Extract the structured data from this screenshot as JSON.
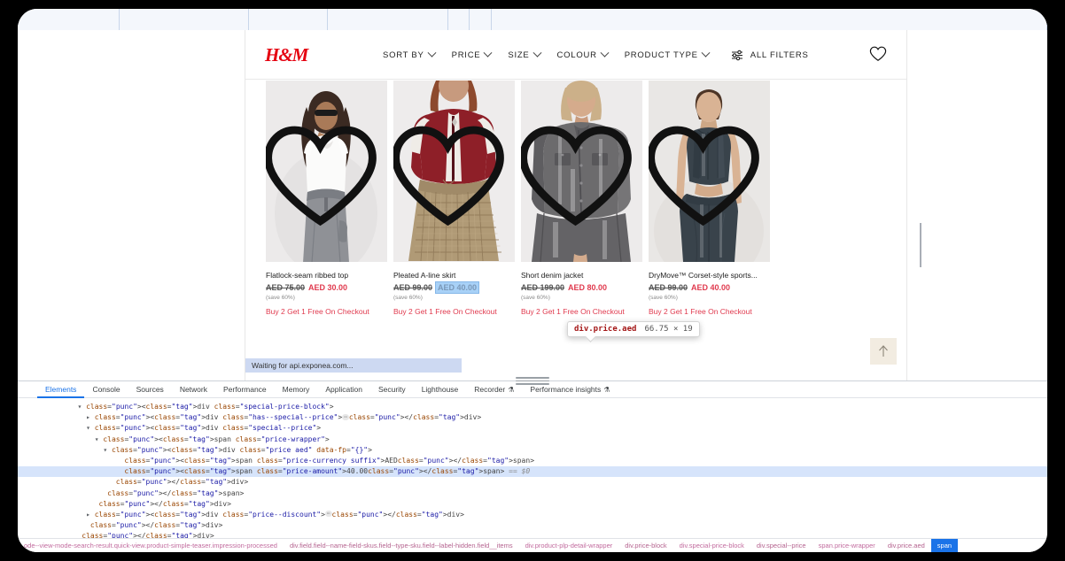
{
  "browser": {
    "tab_strip_segments": 7
  },
  "site": {
    "brand_logo": "H&M",
    "brand_color": "#e50010",
    "filters": [
      {
        "label": "SORT BY",
        "has_chevron": true,
        "icon": "chevron-down-icon"
      },
      {
        "label": "PRICE",
        "has_chevron": true,
        "icon": "chevron-down-icon"
      },
      {
        "label": "SIZE",
        "has_chevron": true,
        "icon": "chevron-down-icon"
      },
      {
        "label": "COLOUR",
        "has_chevron": true,
        "icon": "chevron-down-icon"
      },
      {
        "label": "PRODUCT TYPE",
        "has_chevron": true,
        "icon": "chevron-down-icon"
      }
    ],
    "all_filters_label": "ALL FILTERS",
    "all_filters_icon": "sliders-icon",
    "header_wishlist_icon": "heart-icon",
    "products": [
      {
        "name": "Flatlock-seam ribbed top",
        "price_old": "AED 75.00",
        "price_new": "AED 30.00",
        "save": "(save 60%)",
        "promo": "Buy 2 Get 1 Free On Checkout",
        "wishlist_icon": "heart-icon",
        "highlighted": false
      },
      {
        "name": "Pleated A-line skirt",
        "price_old": "AED 99.00",
        "price_new": "AED 40.00",
        "save": "(save 60%)",
        "promo": "Buy 2 Get 1 Free On Checkout",
        "wishlist_icon": "heart-icon",
        "highlighted": true
      },
      {
        "name": "Short denim jacket",
        "price_old": "AED 199.00",
        "price_new": "AED 80.00",
        "save": "(save 60%)",
        "promo": "Buy 2 Get 1 Free On Checkout",
        "wishlist_icon": "heart-icon",
        "highlighted": false
      },
      {
        "name": "DryMove™ Corset-style sports...",
        "price_old": "AED 99.00",
        "price_new": "AED 40.00",
        "save": "(save 60%)",
        "promo": "Buy 2 Get 1 Free On Checkout",
        "wishlist_icon": "heart-icon",
        "highlighted": false
      }
    ],
    "status_text": "Waiting for api.exponea.com...",
    "scroll_top_icon": "arrow-up-icon"
  },
  "inspector_tooltip": {
    "selector": "div.price.aed",
    "dimensions": "66.75 × 19"
  },
  "devtools": {
    "tabs": [
      {
        "label": "Elements",
        "active": true,
        "icon": null
      },
      {
        "label": "Console",
        "active": false,
        "icon": null
      },
      {
        "label": "Sources",
        "active": false,
        "icon": null
      },
      {
        "label": "Network",
        "active": false,
        "icon": null
      },
      {
        "label": "Performance",
        "active": false,
        "icon": null
      },
      {
        "label": "Memory",
        "active": false,
        "icon": null
      },
      {
        "label": "Application",
        "active": false,
        "icon": null
      },
      {
        "label": "Security",
        "active": false,
        "icon": null
      },
      {
        "label": "Lighthouse",
        "active": false,
        "icon": null
      },
      {
        "label": "Recorder",
        "active": false,
        "icon": "flask-icon"
      },
      {
        "label": "Performance insights",
        "active": false,
        "icon": "flask-icon"
      }
    ],
    "dom_lines": [
      {
        "indent": 14,
        "tri": "down",
        "text": "<div class=\"special-price-block\">",
        "selected": false
      },
      {
        "indent": 16,
        "tri": "right",
        "text": "<div class=\"has--special--price\">…</div>",
        "selected": false
      },
      {
        "indent": 16,
        "tri": "down",
        "text": "<div class=\"special--price\">",
        "selected": false
      },
      {
        "indent": 18,
        "tri": "down",
        "text": "<span class=\"price-wrapper\">",
        "selected": false
      },
      {
        "indent": 20,
        "tri": "down",
        "text": "<div class=\"price aed\" data-fp=\"{}\">",
        "selected": false
      },
      {
        "indent": 23,
        "tri": "none",
        "text": "<span class=\"price-currency suffix\">AED</span>",
        "selected": false
      },
      {
        "indent": 23,
        "tri": "none",
        "text": "<span class=\"price-amount\">40.00</span> == $0",
        "selected": true
      },
      {
        "indent": 21,
        "tri": "none",
        "text": "</div>",
        "selected": false
      },
      {
        "indent": 19,
        "tri": "none",
        "text": "</span>",
        "selected": false
      },
      {
        "indent": 17,
        "tri": "none",
        "text": "</div>",
        "selected": false
      },
      {
        "indent": 16,
        "tri": "right",
        "text": "<div class=\"price--discount\">…</div>",
        "selected": false
      },
      {
        "indent": 15,
        "tri": "none",
        "text": "</div>",
        "selected": false
      },
      {
        "indent": 13,
        "tri": "none",
        "text": "</div>",
        "selected": false
      }
    ],
    "breadcrumbs": [
      {
        "label": "ode--view-mode-search-result.quick-view.product-simple-teaser.impression-processed",
        "active": false
      },
      {
        "label": "div.field.field--name-field-skus.field--type-sku.field--label-hidden.field__items",
        "active": false
      },
      {
        "label": "div.product-plp-detail-wrapper",
        "active": false
      },
      {
        "label": "div.price-block",
        "active": false
      },
      {
        "label": "div.special-price-block",
        "active": false
      },
      {
        "label": "div.special--price",
        "active": false
      },
      {
        "label": "span.price-wrapper",
        "active": false
      },
      {
        "label": "div.price.aed",
        "active": false
      },
      {
        "label": "span",
        "active": true
      }
    ]
  }
}
